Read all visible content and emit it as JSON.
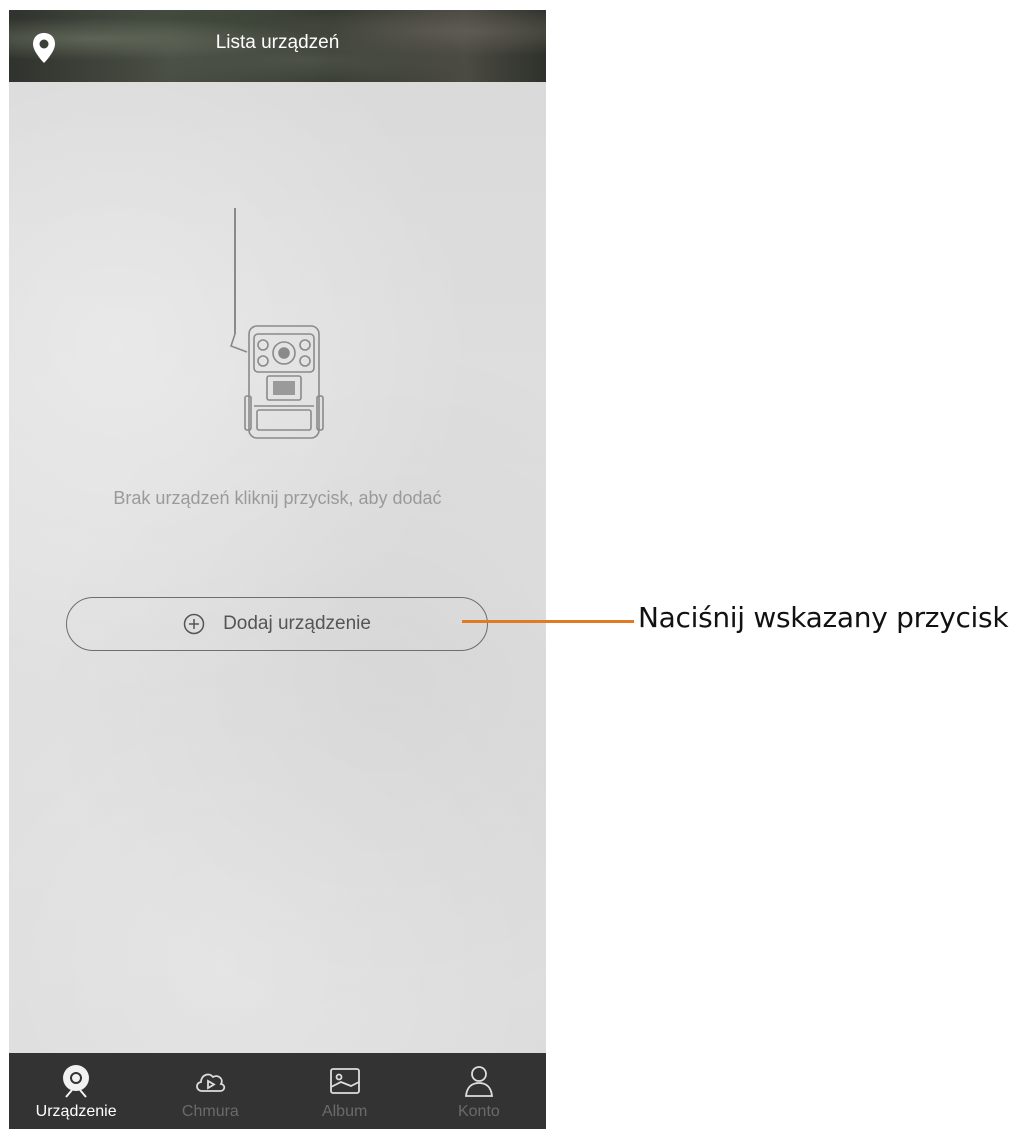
{
  "header": {
    "title": "Lista urządzeń",
    "left_icon": "location-pin-icon"
  },
  "main": {
    "illustration": "trail-camera-icon",
    "empty_message": "Brak urządzeń kliknij przycisk, aby dodać",
    "add_button": {
      "label": "Dodaj urządzenie",
      "icon": "plus-circle-icon"
    }
  },
  "tabs": [
    {
      "label": "Urządzenie",
      "icon": "camera-device-icon",
      "active": true
    },
    {
      "label": "Chmura",
      "icon": "cloud-play-icon",
      "active": false
    },
    {
      "label": "Album",
      "icon": "image-icon",
      "active": false
    },
    {
      "label": "Konto",
      "icon": "user-icon",
      "active": false
    }
  ],
  "annotation": {
    "text": "Naciśnij wskazany przycisk",
    "color": "#e07b25"
  }
}
